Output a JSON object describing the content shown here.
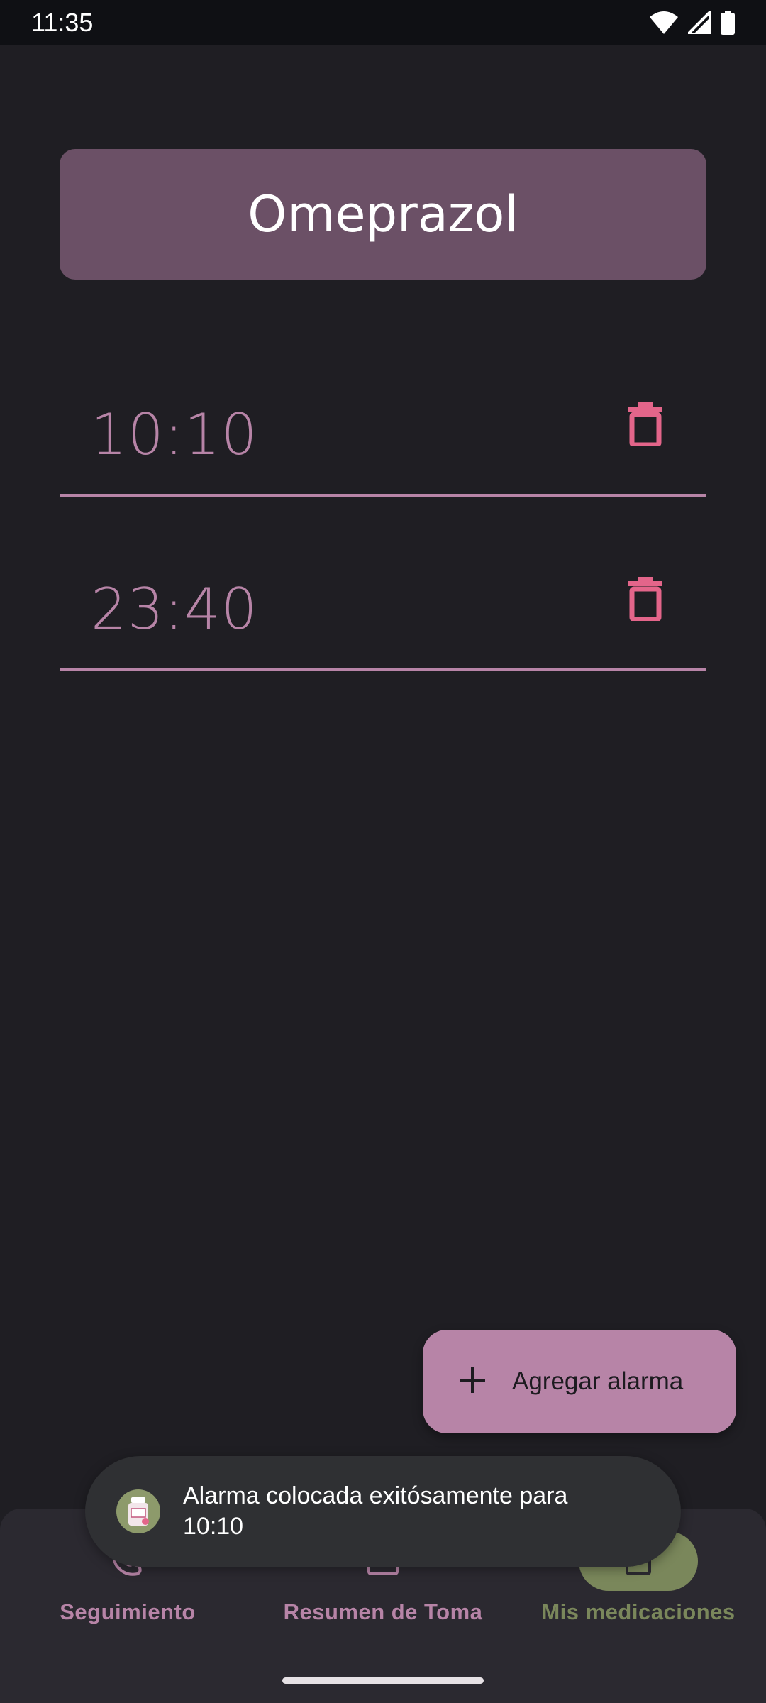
{
  "status_bar": {
    "time": "11:35",
    "icons": [
      "wifi-icon",
      "signal-icon",
      "battery-icon"
    ]
  },
  "medication": {
    "name": "Omeprazol"
  },
  "alarms": [
    {
      "time": "10:10",
      "action_icon": "trash-icon"
    },
    {
      "time": "23:40",
      "action_icon": "trash-icon"
    }
  ],
  "fab": {
    "label": "Agregar alarma",
    "icon": "plus-icon"
  },
  "toast": {
    "message": "Alarma colocada exitósamente para\n10:10",
    "icon": "app-logo-icon"
  },
  "bottom_nav": {
    "items": [
      {
        "label": "Seguimiento",
        "icon": "tracking-icon",
        "active": false
      },
      {
        "label": "Resumen de Toma",
        "icon": "summary-icon",
        "active": false
      },
      {
        "label": "Mis medicaciones",
        "icon": "medications-icon",
        "active": true
      }
    ]
  },
  "colors": {
    "background": "#1f1e23",
    "primary": "#b784a7",
    "card": "#6b5066",
    "delete": "#e3658a",
    "active_nav": "#7a875b"
  }
}
